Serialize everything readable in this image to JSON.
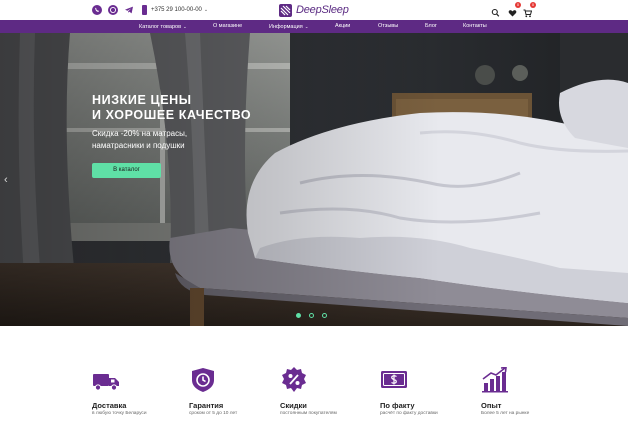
{
  "header": {
    "social_icons": [
      "viber-icon",
      "whatsapp-icon",
      "telegram-icon"
    ],
    "phone": "+375 29 100-00-00",
    "logo_text": "DeepSleep",
    "cart_count": "0",
    "favorites_count": "0"
  },
  "nav": {
    "items": [
      {
        "label": "Каталог товаров",
        "dropdown": true
      },
      {
        "label": "О магазине",
        "dropdown": false
      },
      {
        "label": "Информация",
        "dropdown": true
      },
      {
        "label": "Акции",
        "dropdown": false
      },
      {
        "label": "Отзывы",
        "dropdown": false
      },
      {
        "label": "Блог",
        "dropdown": false
      },
      {
        "label": "Контакты",
        "dropdown": false
      }
    ]
  },
  "hero": {
    "title_line1": "НИЗКИЕ ЦЕНЫ",
    "title_line2": "И ХОРОШЕЕ КАЧЕСТВО",
    "subtitle_line1": "Скидка -20% на матрасы,",
    "subtitle_line2": "наматрасники и подушки",
    "button_label": "В каталог",
    "slides_count": 3,
    "active_slide": 1
  },
  "features": [
    {
      "icon": "truck-icon",
      "title": "Доставка",
      "desc": "в любую точку Беларуси"
    },
    {
      "icon": "shield-clock-icon",
      "title": "Гарантия",
      "desc": "сроком от 5 до 10 лет"
    },
    {
      "icon": "discount-badge-icon",
      "title": "Скидки",
      "desc": "постоянным покупателям"
    },
    {
      "icon": "cash-icon",
      "title": "По факту",
      "desc": "расчёт по факту доставки"
    },
    {
      "icon": "growth-chart-icon",
      "title": "Опыт",
      "desc": "Более 5 лет на рынке"
    }
  ],
  "colors": {
    "brand_purple": "#5e2a84",
    "accent_green": "#5fe0a6",
    "badge_red": "#e53935"
  }
}
